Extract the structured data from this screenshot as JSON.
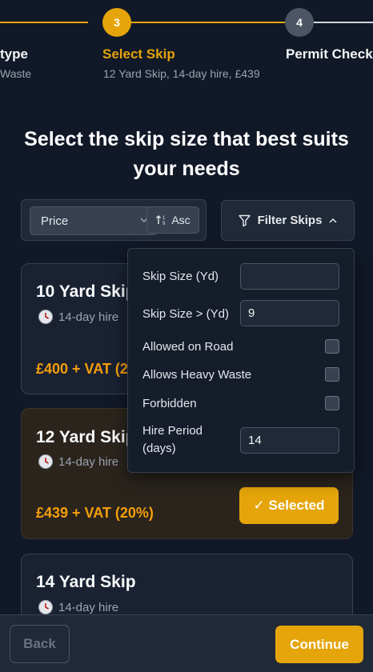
{
  "stepper": {
    "current_step_number": "3",
    "next_step_number": "4",
    "prev_step_title": "type",
    "prev_step_subtitle": "Waste",
    "current_step_title": "Select Skip",
    "current_step_subtitle": "12 Yard Skip, 14-day hire, £439",
    "next_step_title": "Permit Check"
  },
  "heading": "Select the skip size that best suits your needs",
  "sort": {
    "selected": "Price",
    "direction_label": "Asc"
  },
  "filter": {
    "button_label": "Filter Skips",
    "fields": {
      "skip_size_label": "Skip Size (Yd)",
      "skip_size_value": "",
      "skip_size_gt_label": "Skip Size > (Yd)",
      "skip_size_gt_value": "9",
      "allowed_on_road_label": "Allowed on Road",
      "allows_heavy_waste_label": "Allows Heavy Waste",
      "forbidden_label": "Forbidden",
      "hire_period_label_line1": "Hire Period",
      "hire_period_label_line2": "(days)",
      "hire_period_value": "14"
    }
  },
  "cards": [
    {
      "title": "10 Yard Skip",
      "hire": "14-day hire",
      "price": "£400 + VAT (20%)"
    },
    {
      "title": "12 Yard Skip",
      "hire": "14-day hire",
      "price": "£439 + VAT (20%)",
      "selected_label": "✓ Selected"
    },
    {
      "title": "14 Yard Skip",
      "hire": "14-day hire"
    }
  ],
  "footer": {
    "back_label": "Back",
    "continue_label": "Continue"
  },
  "colors": {
    "accent": "#e5a50a",
    "background": "#111827",
    "inactive_step": "#4b5563"
  }
}
